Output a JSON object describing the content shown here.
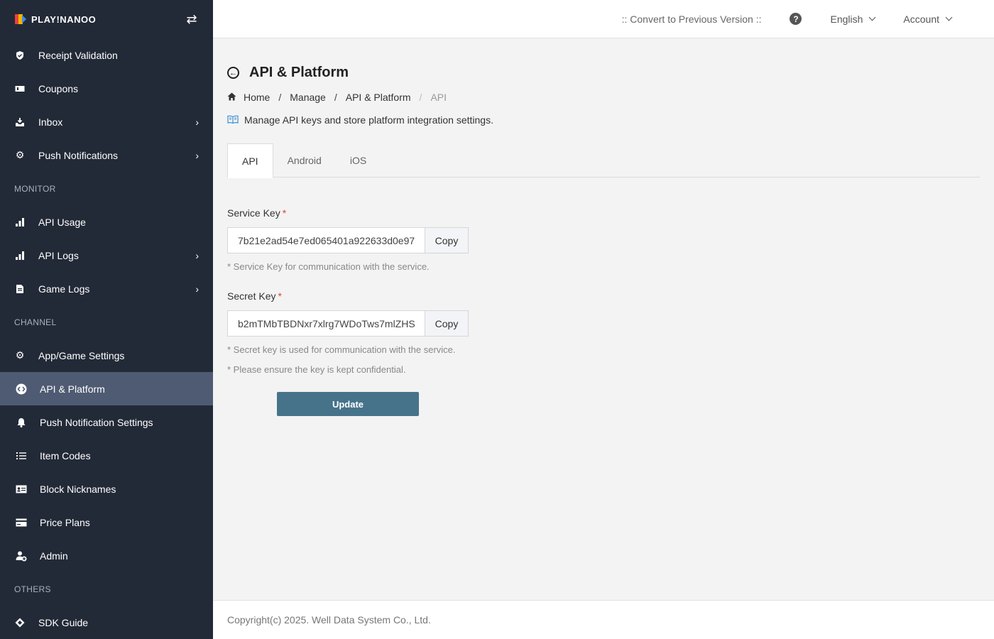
{
  "brand": {
    "name": "PLAY!NANOO"
  },
  "sidebar": {
    "items": [
      {
        "label": "Receipt Validation",
        "icon": "shield-check-icon",
        "chevron": false
      },
      {
        "label": "Coupons",
        "icon": "ticket-icon",
        "chevron": false
      },
      {
        "label": "Inbox",
        "icon": "inbox-download-icon",
        "chevron": true
      },
      {
        "label": "Push Notifications",
        "icon": "gear-icon",
        "chevron": true
      }
    ],
    "sections": {
      "monitor": "MONITOR",
      "channel": "CHANNEL",
      "others": "OTHERS"
    },
    "monitor_items": [
      {
        "label": "API Usage",
        "icon": "bar-chart-icon",
        "chevron": false
      },
      {
        "label": "API Logs",
        "icon": "bar-chart-icon",
        "chevron": true
      },
      {
        "label": "Game Logs",
        "icon": "document-icon",
        "chevron": true
      }
    ],
    "channel_items": [
      {
        "label": "App/Game Settings",
        "icon": "gear-icon"
      },
      {
        "label": "API & Platform",
        "icon": "code-icon",
        "active": true
      },
      {
        "label": "Push Notification Settings",
        "icon": "bell-icon"
      },
      {
        "label": "Item Codes",
        "icon": "list-icon"
      },
      {
        "label": "Block Nicknames",
        "icon": "id-card-icon"
      },
      {
        "label": "Price Plans",
        "icon": "credit-card-icon"
      },
      {
        "label": "Admin",
        "icon": "user-plus-icon"
      }
    ],
    "others_items": [
      {
        "label": "SDK Guide",
        "icon": "diamond-icon"
      }
    ]
  },
  "topbar": {
    "convert": ":: Convert to Previous Version ::",
    "language": "English",
    "account": "Account"
  },
  "page": {
    "title": "API & Platform",
    "breadcrumb": [
      "Home",
      "Manage",
      "API & Platform",
      "API"
    ],
    "description": "Manage API keys and store platform integration settings."
  },
  "tabs": [
    "API",
    "Android",
    "iOS"
  ],
  "form": {
    "service_key_label": "Service Key",
    "service_key_value": "7b21e2ad54e7ed065401a922633d0e97",
    "service_key_hint": "* Service Key for communication with the service.",
    "secret_key_label": "Secret Key",
    "secret_key_value": "b2mTMbTBDNxr7xlrg7WDoTws7mlZHS",
    "secret_key_hint1": "* Secret key is used for communication with the service.",
    "secret_key_hint2": "* Please ensure the key is kept confidential.",
    "copy_label": "Copy",
    "update_label": "Update",
    "required_mark": "*"
  },
  "footer": {
    "text": "Copyright(c) 2025. Well Data System Co., Ltd."
  },
  "colors": {
    "sidebar_bg": "#232a37",
    "active_bg": "#4f5b73",
    "button": "#46738a",
    "required": "#e0402e"
  }
}
